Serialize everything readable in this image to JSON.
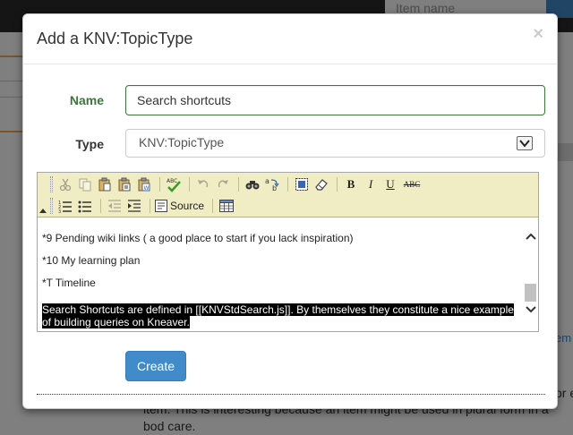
{
  "background": {
    "search_placeholder": "Item name",
    "link_fragment": "em",
    "body_text": "item. This is interesting because an item might be used in plural form in a bod care.",
    "side_fragment": "or e"
  },
  "modal": {
    "title": "Add a KNV:TopicType",
    "close_glyph": "×",
    "name_label": "Name",
    "name_value": "Search shortcuts",
    "type_label": "Type",
    "type_selected": "KNV:TopicType",
    "create_label": "Create"
  },
  "editor": {
    "source_label": "Source",
    "toolbar_icons": [
      "cut-icon",
      "copy-icon",
      "paste-icon",
      "paste-text-icon",
      "paste-word-icon",
      "spellcheck-icon",
      "undo-icon",
      "redo-icon",
      "find-icon",
      "replace-icon",
      "select-all-icon",
      "remove-format-icon",
      "bold-icon",
      "italic-icon",
      "underline-icon",
      "strikethrough-icon",
      "numbered-list-icon",
      "bulleted-list-icon",
      "outdent-icon",
      "indent-icon",
      "source-icon",
      "table-icon"
    ],
    "format": {
      "bold": "B",
      "italic": "I",
      "underline": "U",
      "strike": "ABC"
    },
    "lines": [
      "*9 Pending wiki links ( a good place to start if you lack inspiration)",
      "*10 My learning plan",
      "*T Timeline"
    ],
    "selected_paragraph": "Search Shortcuts are defined in [[KNVStdSearch.js]].  By themselves they constitute a nice example of building queries on Kneaver."
  },
  "colors": {
    "primary": "#428bca",
    "success_label": "#3c763d",
    "toolbar_bg": "#f0edc4"
  }
}
